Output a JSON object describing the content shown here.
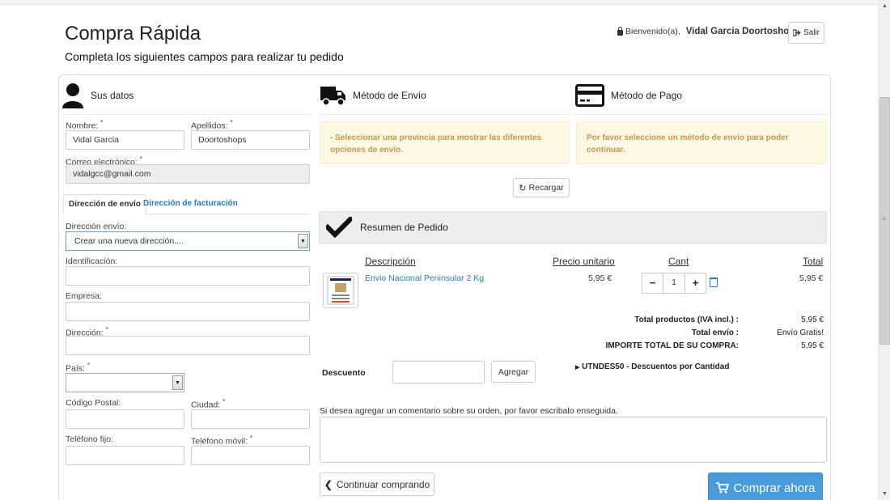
{
  "header": {
    "title": "Compra Rápida",
    "subtitle": "Completa los siguientes campos para realizar tu pedido",
    "welcome": "Bienvenido(a),",
    "user_name": "Vidal Garcia Doortoshops",
    "logout": "Salir"
  },
  "customer": {
    "heading": "Sus datos",
    "first_name_label": "Nombre:",
    "first_name_value": "Vidal Garcia",
    "last_name_label": "Apellidos:",
    "last_name_value": "Doortoshops",
    "email_label": "Correo electrónico:",
    "email_value": "vidalgcc@gmail.com",
    "tabs": [
      "Dirección de envío",
      "Dirección de facturación"
    ],
    "address_select_label": "Dirección envío:",
    "address_select_value": "Crear una nueva dirección....",
    "id_label": "Identificación:",
    "company_label": "Empresa:",
    "address_label": "Dirección:",
    "country_label": "País:",
    "zip_label": "Código Postal:",
    "city_label": "Ciudad:",
    "phone_label": "Teléfono fijo:",
    "mobile_label": "Teléfono móvil:",
    "required_mark": "*"
  },
  "shipping": {
    "heading": "Método de Envío",
    "notice": "- Seleccionar una provincia para mostrar las diferentes opciones de envío.",
    "reload": "Recargar"
  },
  "payment": {
    "heading": "Método de Pago",
    "notice": "Por favor seleccione un método de envio para poder continuar."
  },
  "summary": {
    "heading": "Resumen de Pedido",
    "columns": {
      "description": "Descripción",
      "unit_price": "Precio unitario",
      "qty": "Cant",
      "total": "Total"
    },
    "items": [
      {
        "name": "Envio Nacional Peninsular 2 Kg",
        "unit_price": "5,95 €",
        "qty": "1",
        "total": "5,95 €"
      }
    ],
    "totals": [
      {
        "label": "Total productos  (IVA incl.) :",
        "value": "5,95 €"
      },
      {
        "label": "Total envío :",
        "value": "Envío Gratis!"
      },
      {
        "label": "IMPORTE TOTAL DE SU COMPRA:",
        "value": "5,95 €"
      }
    ],
    "discount_label": "Descuento",
    "discount_button": "Agregar",
    "promo": "UTNDES50 - Descuentos por Cantidad",
    "comment_label": "Si desea agregar un comentario sobre su orden, por favor escribalo enseguida.",
    "continue_button": "Continuar comprando",
    "buy_button": "Comprar ahora"
  },
  "colors": {
    "link": "#2a7bbd",
    "primary_button": "#4a9bdc",
    "alert_bg": "#fcf8e3",
    "alert_text": "#c09853"
  }
}
